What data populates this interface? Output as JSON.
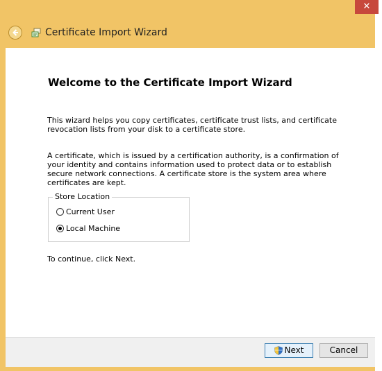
{
  "window": {
    "title": "Certificate Import Wizard",
    "close_glyph": "✕"
  },
  "page": {
    "heading": "Welcome to the Certificate Import Wizard",
    "intro": "This wizard helps you copy certificates, certificate trust lists, and certificate revocation lists from your disk to a certificate store.",
    "description": "A certificate, which is issued by a certification authority, is a confirmation of your identity and contains information used to protect data or to establish secure network connections. A certificate store is the system area where certificates are kept.",
    "continue_text": "To continue, click Next."
  },
  "store_location": {
    "label": "Store Location",
    "options": [
      {
        "label": "Current User",
        "selected": false
      },
      {
        "label": "Local Machine",
        "selected": true
      }
    ]
  },
  "footer": {
    "next_label": "Next",
    "cancel_label": "Cancel"
  },
  "icons": {
    "back": "back-arrow-icon",
    "wizard": "certificate-wizard-icon",
    "shield": "uac-shield-icon"
  },
  "colors": {
    "frame": "#f1c466",
    "close": "#c7483c",
    "next_border": "#3c7fb1"
  }
}
